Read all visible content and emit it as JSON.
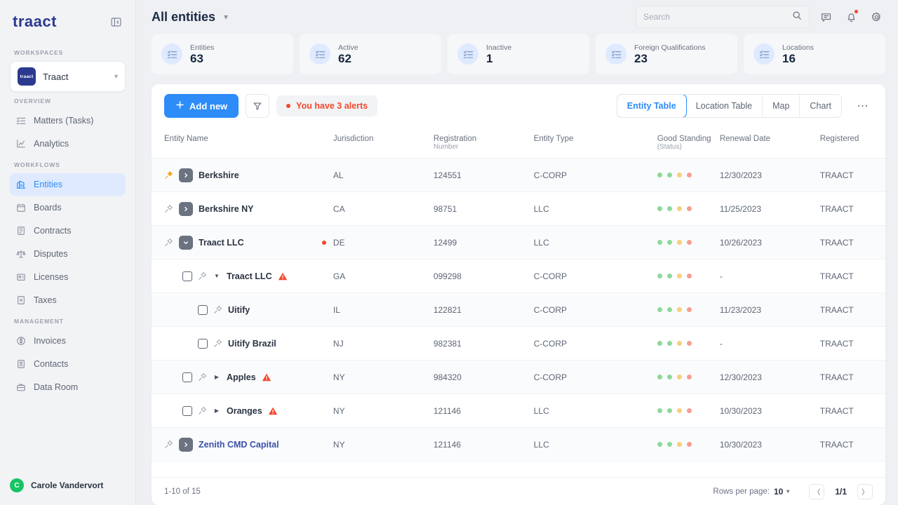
{
  "sidebar": {
    "brand": "traact",
    "collapse_icon": "panel-collapse-icon",
    "workspaces_label": "WORKSPACES",
    "workspace": {
      "name": "Traact",
      "logo_text": "traact"
    },
    "groups": [
      {
        "label": "OVERVIEW",
        "items": [
          {
            "label": "Matters (Tasks)",
            "icon": "checklist-icon",
            "active": false
          },
          {
            "label": "Analytics",
            "icon": "chart-icon",
            "active": false
          }
        ]
      },
      {
        "label": "WORKFLOWS",
        "items": [
          {
            "label": "Entities",
            "icon": "building-icon",
            "active": true
          },
          {
            "label": "Boards",
            "icon": "calendar-icon",
            "active": false
          },
          {
            "label": "Contracts",
            "icon": "document-icon",
            "active": false
          },
          {
            "label": "Disputes",
            "icon": "scales-icon",
            "active": false
          },
          {
            "label": "Licenses",
            "icon": "license-icon",
            "active": false
          },
          {
            "label": "Taxes",
            "icon": "tax-icon",
            "active": false
          }
        ]
      },
      {
        "label": "MANAGEMENT",
        "items": [
          {
            "label": "Invoices",
            "icon": "dollar-circle-icon",
            "active": false
          },
          {
            "label": "Contacts",
            "icon": "contact-card-icon",
            "active": false
          },
          {
            "label": "Data Room",
            "icon": "briefcase-icon",
            "active": false
          }
        ]
      }
    ],
    "user": {
      "name": "Carole Vandervort",
      "initial": "C",
      "avatar_color": "#16c464"
    }
  },
  "topbar": {
    "title": "All entities",
    "search_placeholder": "Search",
    "search_value": "",
    "icons": [
      "message-icon",
      "bell-icon",
      "gear-icon"
    ]
  },
  "stats": [
    {
      "label": "Entities",
      "value": "63",
      "icon": "checklist-icon"
    },
    {
      "label": "Active",
      "value": "62",
      "icon": "checklist-icon"
    },
    {
      "label": "Inactive",
      "value": "1",
      "icon": "checklist-icon"
    },
    {
      "label": "Foreign Qualifications",
      "value": "23",
      "icon": "checklist-icon"
    },
    {
      "label": "Locations",
      "value": "16",
      "icon": "checklist-icon"
    }
  ],
  "toolbar": {
    "add_new": "Add new",
    "filter_icon": "filter-icon",
    "alerts_text": "You have 3 alerts",
    "more_icon": "more-horizontal-icon",
    "tabs": [
      {
        "label": "Entity Table",
        "active": true
      },
      {
        "label": "Location Table",
        "active": false
      },
      {
        "label": "Map",
        "active": false
      },
      {
        "label": "Chart",
        "active": false
      }
    ]
  },
  "table": {
    "columns": [
      {
        "label": "Entity Name",
        "sub": ""
      },
      {
        "label": "Jurisdiction",
        "sub": ""
      },
      {
        "label": "Registration",
        "sub": "Number"
      },
      {
        "label": "Entity Type",
        "sub": ""
      },
      {
        "label": "Good Standing",
        "sub": "(Status)"
      },
      {
        "label": "Renewal Date",
        "sub": ""
      },
      {
        "label": "Registered",
        "sub": ""
      }
    ],
    "status_colors": [
      "#8ed99a",
      "#8ed99a",
      "#f7cf7e",
      "#f79d93"
    ],
    "rows": [
      {
        "name": "Berkshire",
        "indent": 0,
        "pinned": true,
        "expand": "right",
        "checkbox": false,
        "warn": false,
        "reddot": false,
        "link": false,
        "jurisdiction": "AL",
        "registration": "124551",
        "type": "C-CORP",
        "renewal": "12/30/2023",
        "registered": "TRAACT"
      },
      {
        "name": "Berkshire NY",
        "indent": 0,
        "pinned": false,
        "expand": "right",
        "checkbox": false,
        "warn": false,
        "reddot": false,
        "link": false,
        "jurisdiction": "CA",
        "registration": "98751",
        "type": "LLC",
        "renewal": "11/25/2023",
        "registered": "TRAACT"
      },
      {
        "name": "Traact LLC",
        "indent": 0,
        "pinned": false,
        "expand": "down",
        "checkbox": false,
        "warn": false,
        "reddot": true,
        "link": false,
        "jurisdiction": "DE",
        "registration": "12499",
        "type": "LLC",
        "renewal": "10/26/2023",
        "registered": "TRAACT"
      },
      {
        "name": "Traact LLC",
        "indent": 1,
        "pinned": false,
        "expand": "caret-down",
        "checkbox": true,
        "warn": true,
        "reddot": false,
        "link": false,
        "jurisdiction": "GA",
        "registration": "099298",
        "type": "C-CORP",
        "renewal": "-",
        "registered": "TRAACT"
      },
      {
        "name": "Uitify",
        "indent": 2,
        "pinned": false,
        "expand": "none",
        "checkbox": true,
        "warn": false,
        "reddot": false,
        "link": false,
        "jurisdiction": "IL",
        "registration": "122821",
        "type": "C-CORP",
        "renewal": "11/23/2023",
        "registered": "TRAACT"
      },
      {
        "name": "Uitify Brazil",
        "indent": 2,
        "pinned": false,
        "expand": "none",
        "checkbox": true,
        "warn": false,
        "reddot": false,
        "link": false,
        "jurisdiction": "NJ",
        "registration": "982381",
        "type": "C-CORP",
        "renewal": "-",
        "registered": "TRAACT"
      },
      {
        "name": "Apples",
        "indent": 1,
        "pinned": false,
        "expand": "caret-right",
        "checkbox": true,
        "warn": true,
        "reddot": false,
        "link": false,
        "jurisdiction": "NY",
        "registration": "984320",
        "type": "C-CORP",
        "renewal": "12/30/2023",
        "registered": "TRAACT"
      },
      {
        "name": "Oranges",
        "indent": 1,
        "pinned": false,
        "expand": "caret-right",
        "checkbox": true,
        "warn": true,
        "reddot": false,
        "link": false,
        "jurisdiction": "NY",
        "registration": "121146",
        "type": "LLC",
        "renewal": "10/30/2023",
        "registered": "TRAACT"
      },
      {
        "name": "Zenith CMD Capital",
        "indent": 0,
        "pinned": false,
        "expand": "right",
        "checkbox": false,
        "warn": false,
        "reddot": false,
        "link": true,
        "jurisdiction": "NY",
        "registration": "121146",
        "type": "LLC",
        "renewal": "10/30/2023",
        "registered": "TRAACT"
      }
    ]
  },
  "footer": {
    "range": "1-10 of 15",
    "rows_per_page_label": "Rows per page:",
    "rows_per_page_value": "10",
    "page_indicator": "1/1",
    "prev_icon": "chevron-left-icon",
    "next_icon": "chevron-right-icon"
  }
}
